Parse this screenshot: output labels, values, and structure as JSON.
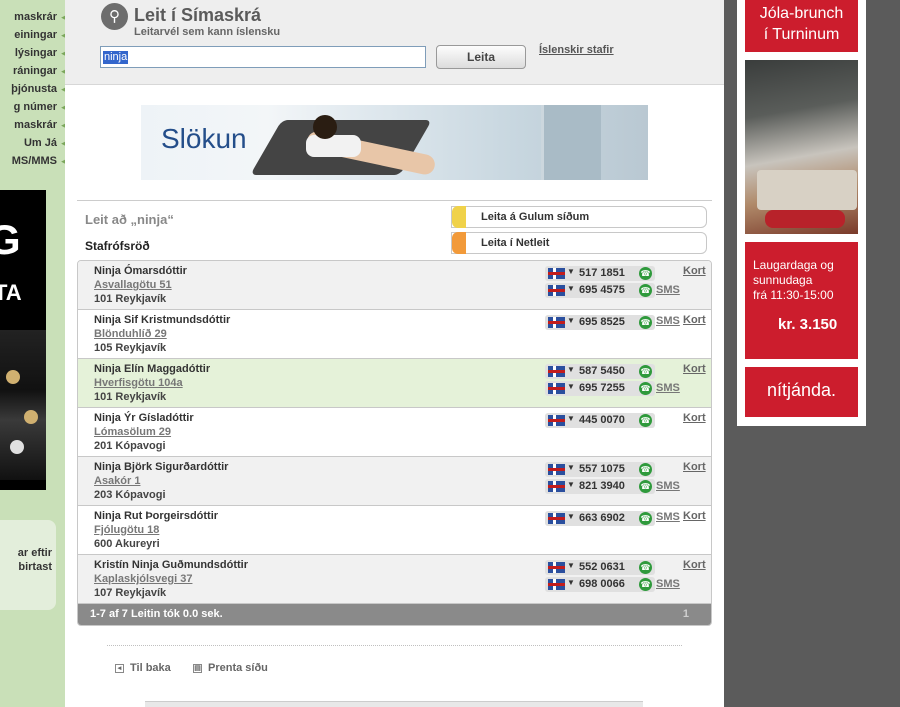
{
  "left_nav": {
    "items": [
      "maskrár",
      "einingar",
      "lýsingar",
      "ráningar",
      "þjónusta",
      "g númer",
      "maskrár",
      "Um Já",
      "MS/MMS"
    ],
    "banner_big": "G",
    "banner_mid": "TA",
    "box_text_1": "ar eftir",
    "box_text_2": "birtast"
  },
  "header": {
    "icon": "magnifier-icon",
    "title": "Leit í Símaskrá",
    "subtitle": "Leitarvél sem kann íslensku",
    "query_value": "ninja",
    "search_button": "Leita",
    "icelandic_chars_link": "Íslenskir stafir"
  },
  "ad_banner": {
    "word": "Slökun"
  },
  "results_header": {
    "query_label": "Leit að „ninja“",
    "order_label": "Stafrófsröð",
    "link_yellow": "Leita á Gulum síðum",
    "link_orange": "Leita í Netleit"
  },
  "results": [
    {
      "name": "Ninja Ómarsdóttir",
      "street": "Asvallagötu 51",
      "city": "101 Reykjavík",
      "phones": [
        "517 1851",
        "695 4575"
      ],
      "sms": [
        false,
        true
      ],
      "kort": "Kort",
      "sms_label": "SMS"
    },
    {
      "name": "Ninja Sif Kristmundsdóttir",
      "street": "Blönduhlíð 29",
      "city": "105 Reykjavík",
      "phones": [
        "695 8525"
      ],
      "sms": [
        true
      ],
      "kort": "Kort",
      "sms_label": "SMS"
    },
    {
      "name": "Ninja Elín Maggadóttir",
      "street": "Hverfisgötu 104a",
      "city": "101 Reykjavík",
      "phones": [
        "587 5450",
        "695 7255"
      ],
      "sms": [
        false,
        true
      ],
      "kort": "Kort",
      "sms_label": "SMS"
    },
    {
      "name": "Ninja Ýr Gísladóttir",
      "street": "Lómasölum 29",
      "city": "201 Kópavogi",
      "phones": [
        "445 0070"
      ],
      "sms": [
        false
      ],
      "kort": "Kort",
      "sms_label": "SMS"
    },
    {
      "name": "Ninja Björk Sigurðardóttir",
      "street": "Asakór 1",
      "city": "203 Kópavogi",
      "phones": [
        "557 1075",
        "821 3940"
      ],
      "sms": [
        false,
        true
      ],
      "kort": "Kort",
      "sms_label": "SMS"
    },
    {
      "name": "Ninja Rut Þorgeirsdóttir",
      "street": "Fjólugötu 18",
      "city": "600 Akureyri",
      "phones": [
        "663 6902"
      ],
      "sms": [
        true
      ],
      "kort": "Kort",
      "sms_label": "SMS"
    },
    {
      "name": "Kristín Ninja Guðmundsdóttir",
      "street": "Kaplaskjólsvegi 37",
      "city": "107 Reykjavík",
      "phones": [
        "552 0631",
        "698 0066"
      ],
      "sms": [
        false,
        true
      ],
      "kort": "Kort",
      "sms_label": "SMS"
    }
  ],
  "footer": {
    "summary": "1-7 af 7    Leitin tók 0.0 sek.",
    "page": "1",
    "back_link": "Til baka",
    "print_link": "Prenta síðu"
  },
  "right_ad": {
    "ad1_line1": "Jóla-brunch",
    "ad1_line2": "í Turninum",
    "ad3_line1": "Laugardaga og",
    "ad3_line2": "sunnudaga",
    "ad3_line3": "frá 11:30-15:00",
    "ad3_price": "kr. 3.150",
    "ad4": "nítjánda."
  }
}
